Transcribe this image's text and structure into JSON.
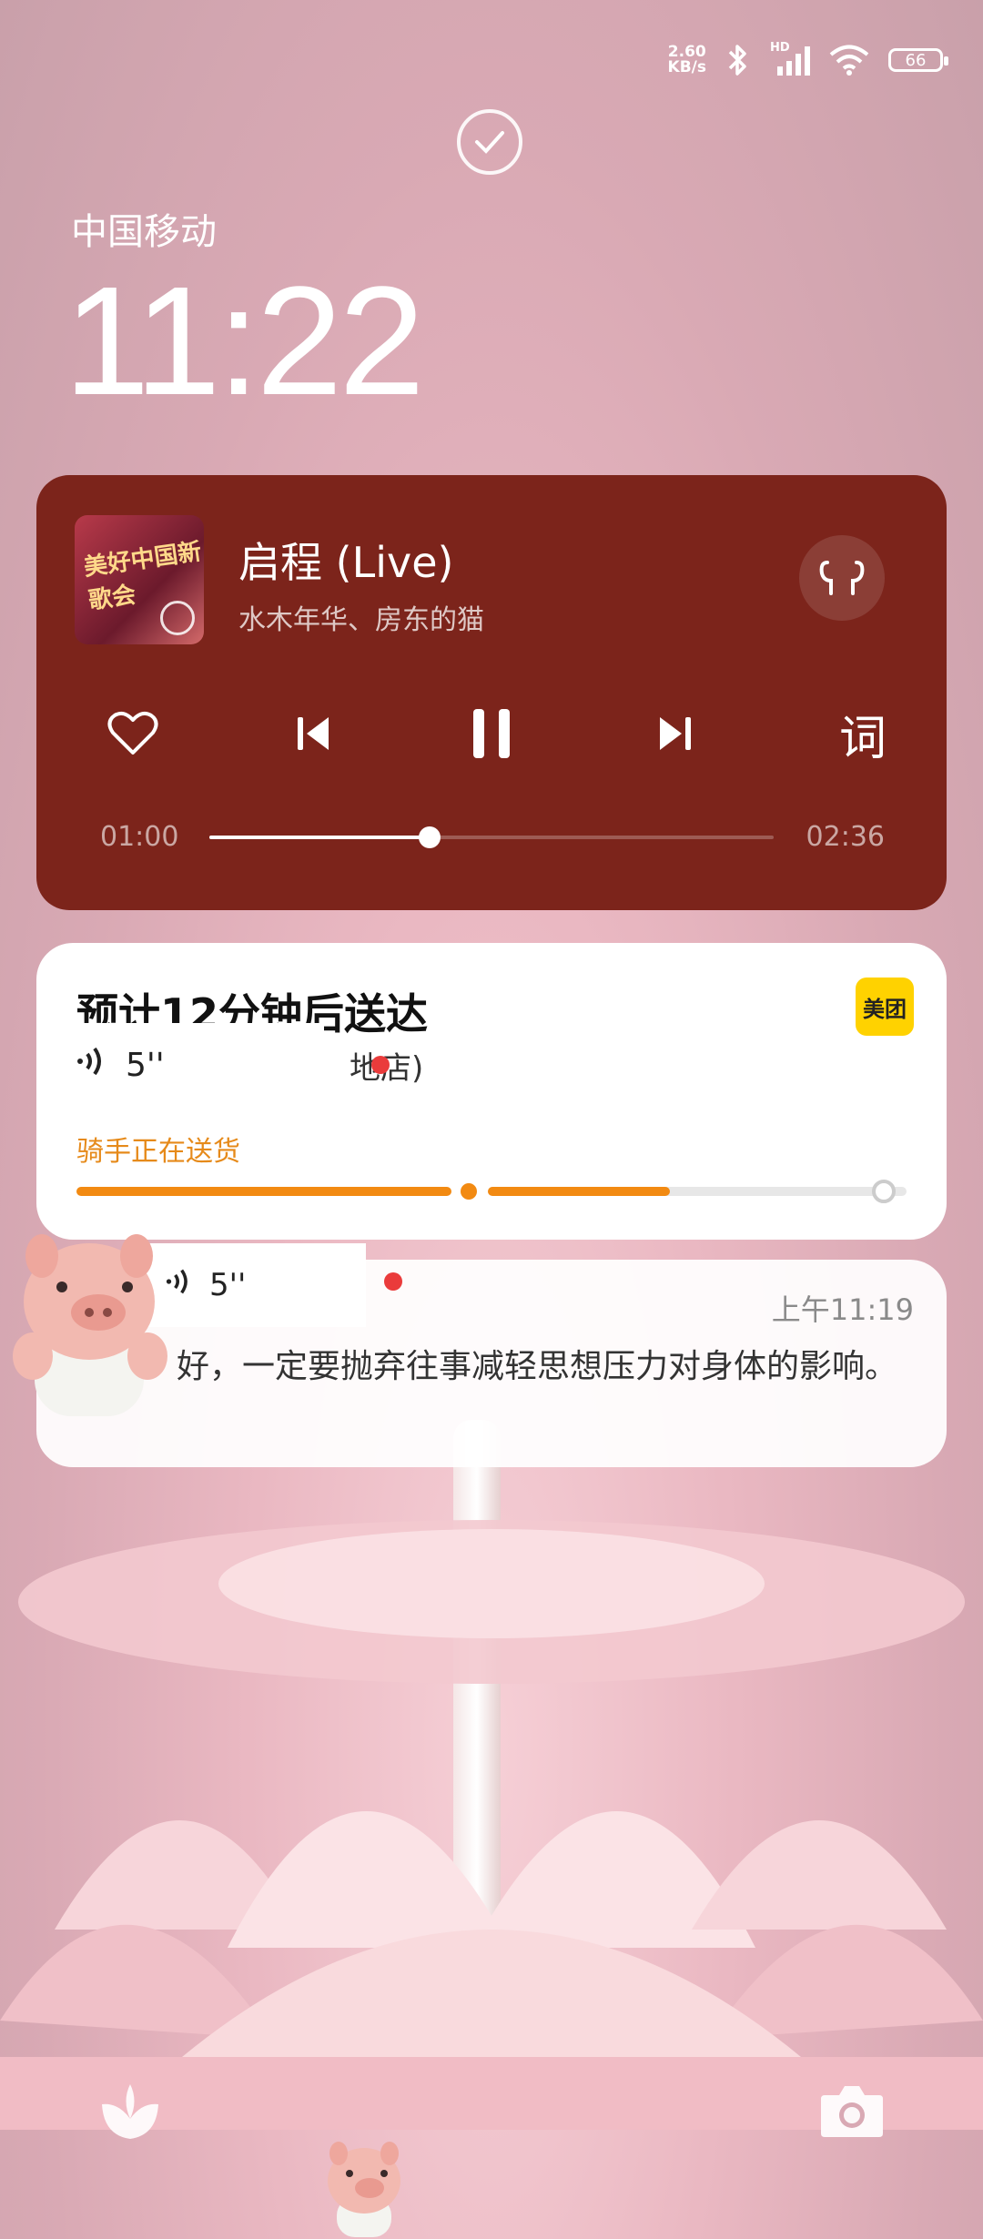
{
  "status_bar": {
    "net_speed_value": "2.60",
    "net_speed_unit": "KB/s",
    "network_tag": "HD",
    "battery": "66"
  },
  "lockscreen": {
    "carrier": "中国移动",
    "time": "11:22"
  },
  "music": {
    "title": "启程 (Live)",
    "artist": "水木年华、房东的猫",
    "album_art_text": "美好中国新歌会",
    "elapsed": "01:00",
    "duration": "02:36",
    "progress": 0.39,
    "lyrics_button": "词",
    "bg_color": "#7c241b"
  },
  "delivery": {
    "title": "预计12分钟后送达",
    "store_fragment": "地店)",
    "brand": "美团",
    "status": "骑手正在送货",
    "voice_duration": "5''",
    "accent_color": "#f28a12"
  },
  "message": {
    "time": "上午11:19",
    "body": "好，一定要抛弃往事减轻思想压力对身体的影响。",
    "voice_duration": "5''"
  }
}
